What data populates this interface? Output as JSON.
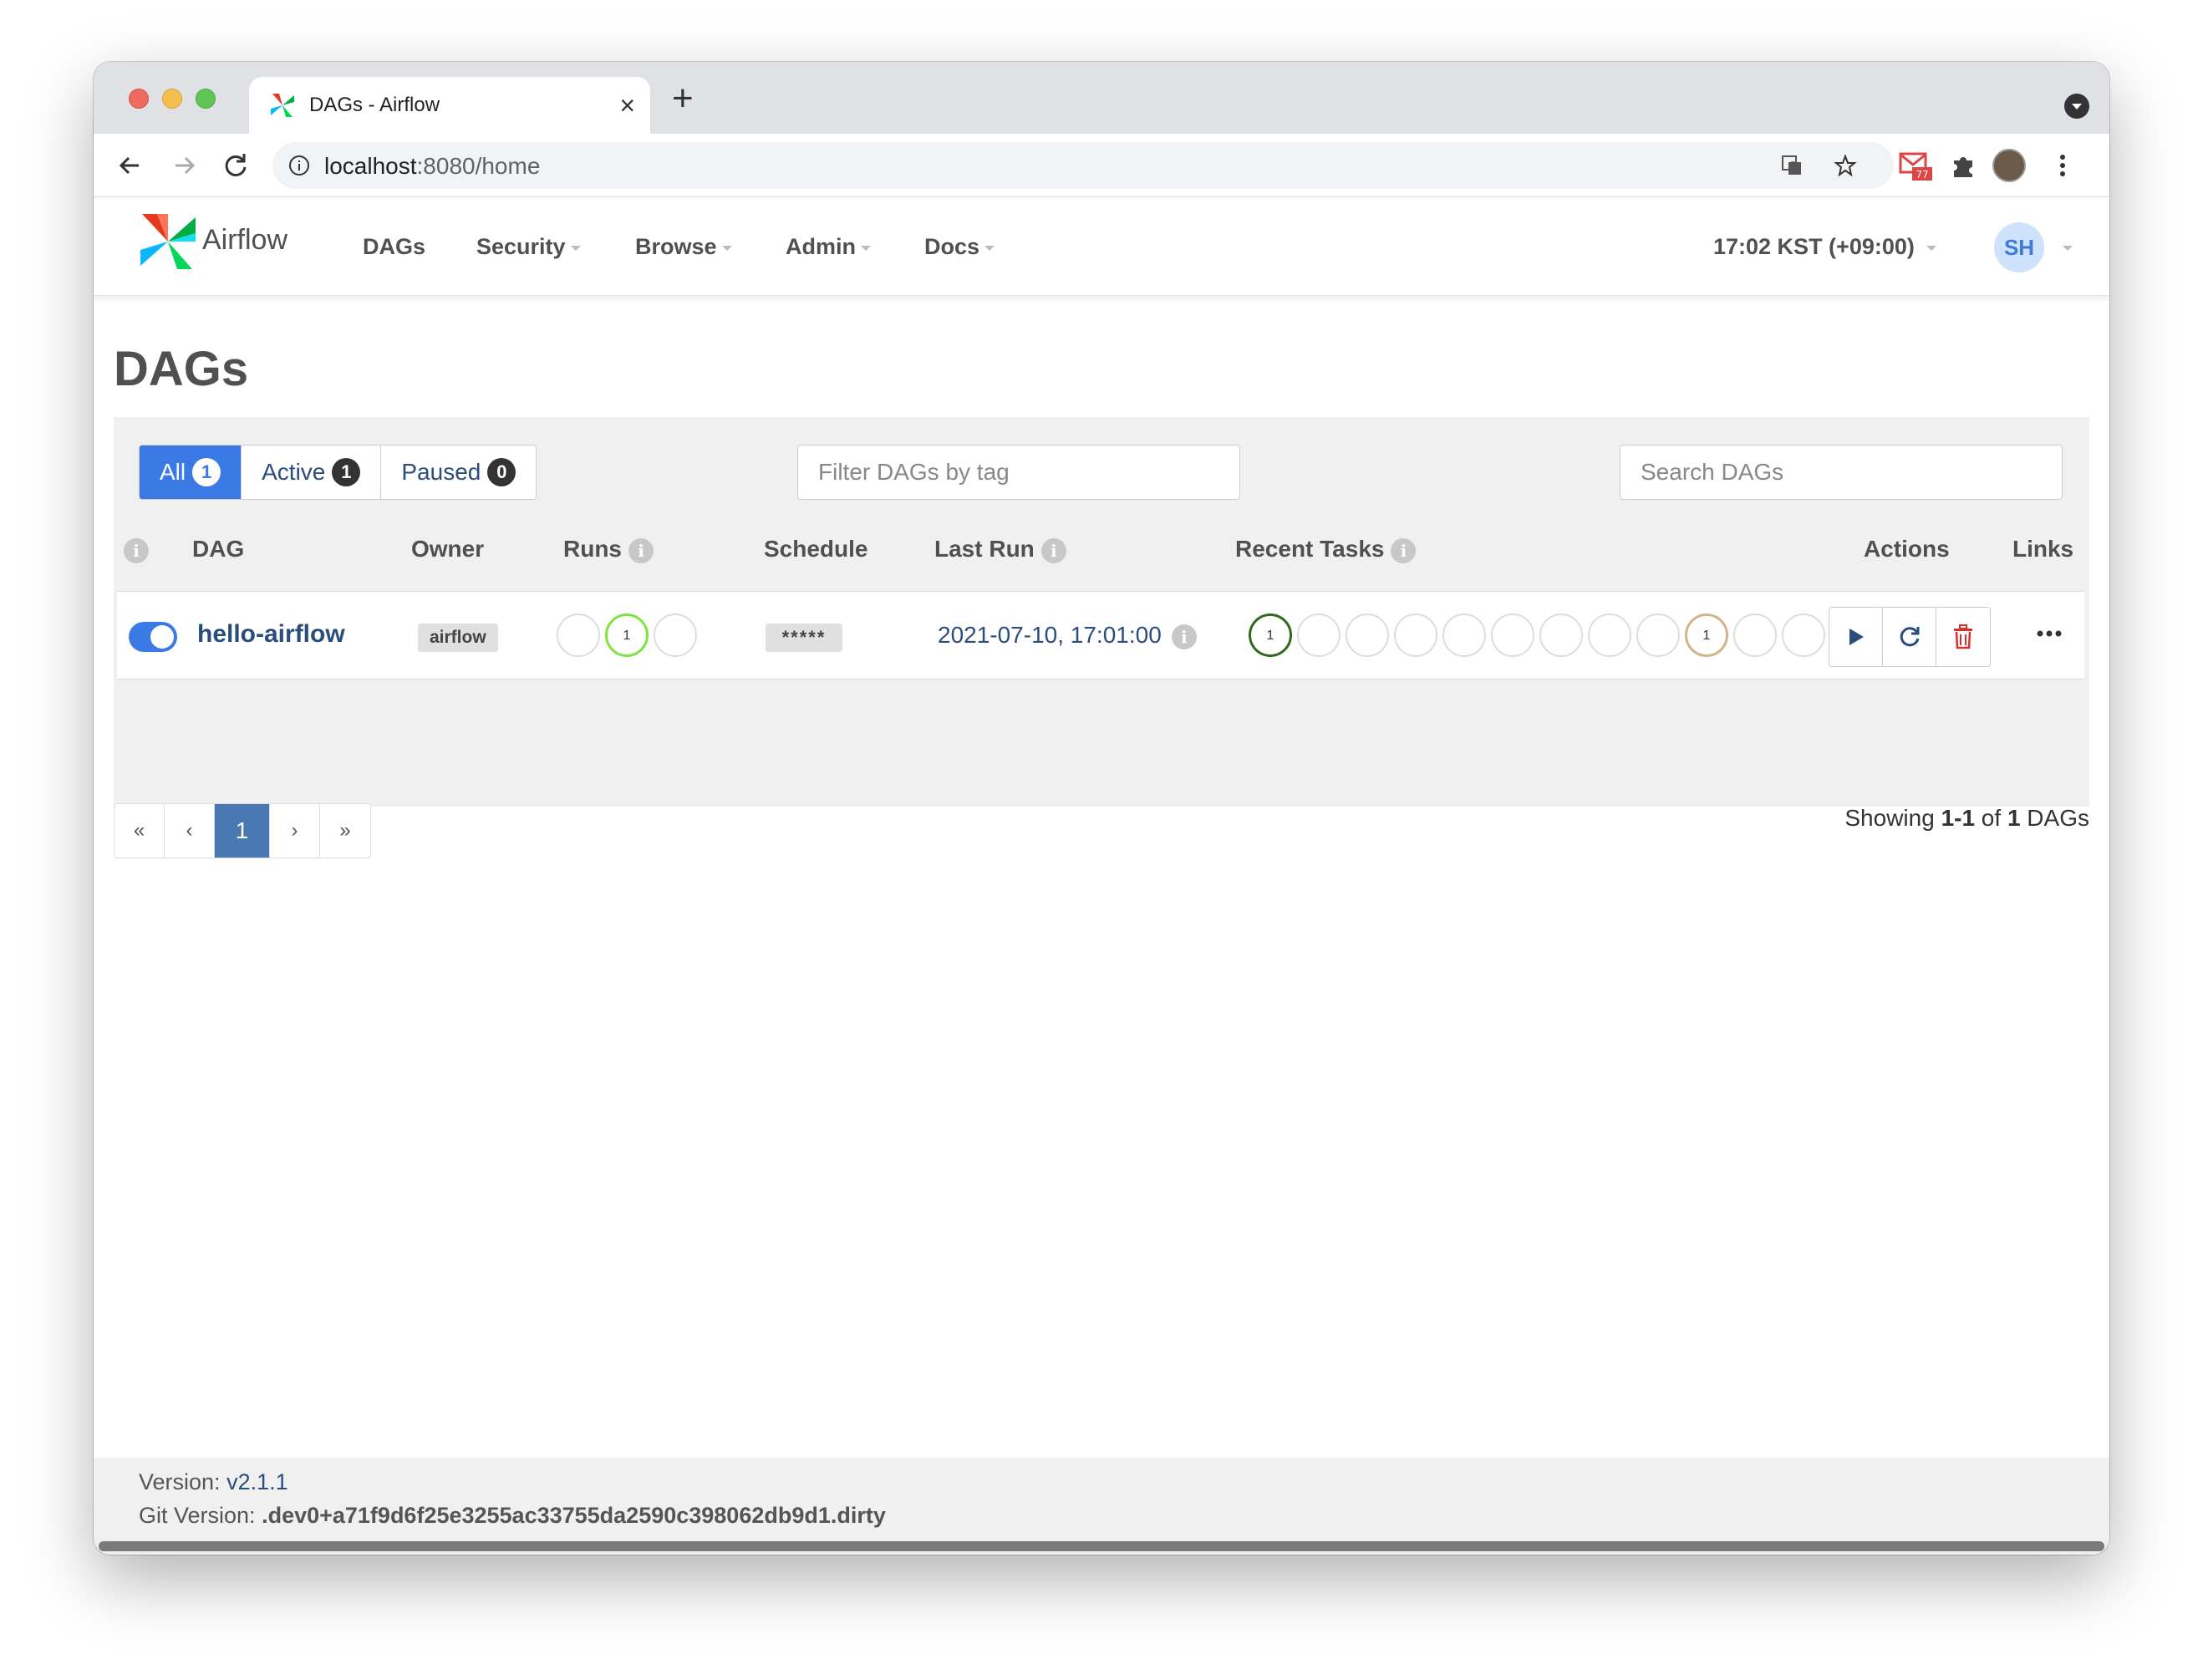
{
  "browser": {
    "tab_title": "DAGs - Airflow",
    "tab_close": "×",
    "new_tab": "+",
    "url_host": "localhost",
    "url_rest": ":8080/home",
    "extension_badge": "77"
  },
  "navbar": {
    "brand": "Airflow",
    "menu": [
      {
        "label": "DAGs",
        "dropdown": false
      },
      {
        "label": "Security",
        "dropdown": true
      },
      {
        "label": "Browse",
        "dropdown": true
      },
      {
        "label": "Admin",
        "dropdown": true
      },
      {
        "label": "Docs",
        "dropdown": true
      }
    ],
    "time": "17:02 KST (+09:00)",
    "user_initials": "SH"
  },
  "page": {
    "title": "DAGs",
    "filters": [
      {
        "label": "All",
        "count": "1",
        "active": true
      },
      {
        "label": "Active",
        "count": "1",
        "active": false
      },
      {
        "label": "Paused",
        "count": "0",
        "active": false
      }
    ],
    "tag_filter_placeholder": "Filter DAGs by tag",
    "search_placeholder": "Search DAGs",
    "columns": {
      "dag": "DAG",
      "owner": "Owner",
      "runs": "Runs",
      "schedule": "Schedule",
      "last_run": "Last Run",
      "recent_tasks": "Recent Tasks",
      "actions": "Actions",
      "links": "Links"
    },
    "info_glyph": "i",
    "dags": [
      {
        "enabled": true,
        "name": "hello-airflow",
        "owner": "airflow",
        "runs": [
          "",
          "1",
          ""
        ],
        "schedule": "*****",
        "last_run": "2021-07-10, 17:01:00",
        "recent_tasks": [
          "1",
          "",
          "",
          "",
          "",
          "",
          "",
          "",
          "",
          "1",
          "",
          ""
        ]
      }
    ],
    "pagination": {
      "first": "«",
      "prev": "‹",
      "current": "1",
      "next": "›",
      "last": "»"
    },
    "showing": {
      "prefix": "Showing ",
      "range": "1-1",
      "of": " of ",
      "total": "1",
      "suffix": " DAGs"
    }
  },
  "footer": {
    "version_label": "Version: ",
    "version": "v2.1.1",
    "git_label": "Git Version: ",
    "git_version": ".dev0+a71f9d6f25e3255ac33755da2590c398062db9d1.dirty"
  },
  "colors": {
    "accent": "#3b7ae5",
    "link": "#2a4d7c",
    "run_success": "#7fe340",
    "task_success": "#2f6a1e",
    "task_upstream_failed": "#d2b48c",
    "delete": "#d9302c"
  }
}
